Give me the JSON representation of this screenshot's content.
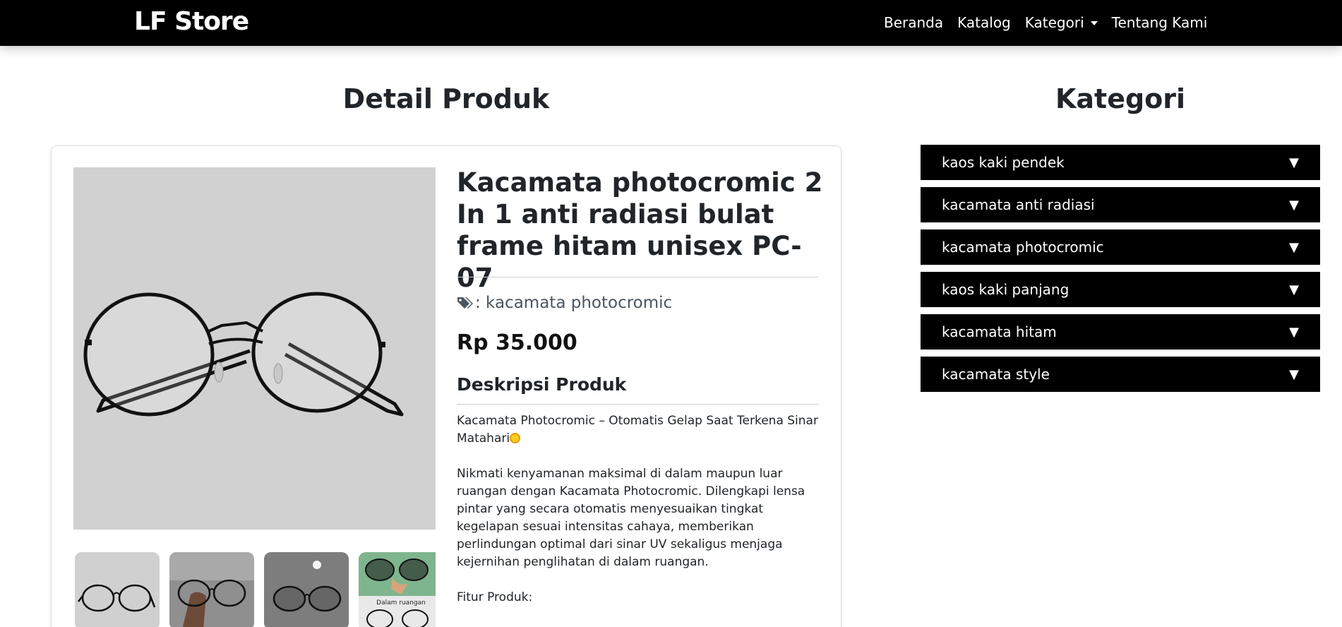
{
  "navbar": {
    "brand": "LF Store",
    "links": [
      {
        "label": "Beranda"
      },
      {
        "label": "Katalog"
      },
      {
        "label": "Kategori"
      },
      {
        "label": "Tentang Kami"
      }
    ]
  },
  "detail": {
    "title": "Detail Produk",
    "product": {
      "name": "Kacamata photocromic 2 In 1 anti radiasi bulat frame hitam unisex PC-07",
      "category_label": ": kacamata photocromic",
      "price": "Rp 35.000",
      "description_heading": "Deskripsi Produk",
      "description_paragraphs": [
        "Kacamata Photocromic – Otomatis Gelap Saat Terkena Sinar Matahari",
        "Nikmati kenyamanan maksimal di dalam maupun luar ruangan dengan Kacamata Photocromic. Dilengkapi lensa pintar yang secara otomatis menyesuaikan tingkat kegelapan sesuai intensitas cahaya, memberikan perlindungan optimal dari sinar UV sekaligus menjaga kejernihan penglihatan di dalam ruangan.",
        "Fitur Produk:"
      ],
      "thumbnail_caption": "Dalam ruangan"
    }
  },
  "sidebar": {
    "title": "Kategori",
    "categories": [
      {
        "label": "kaos kaki pendek"
      },
      {
        "label": "kacamata anti radiasi"
      },
      {
        "label": "kacamata photocromic"
      },
      {
        "label": "kaos kaki panjang"
      },
      {
        "label": "kacamata hitam"
      },
      {
        "label": "kacamata style"
      }
    ],
    "expand_glyph": "▼"
  },
  "icons": {
    "tag": "tags-icon",
    "sun": "sun-emoji-icon",
    "caret": "caret-down-icon"
  }
}
